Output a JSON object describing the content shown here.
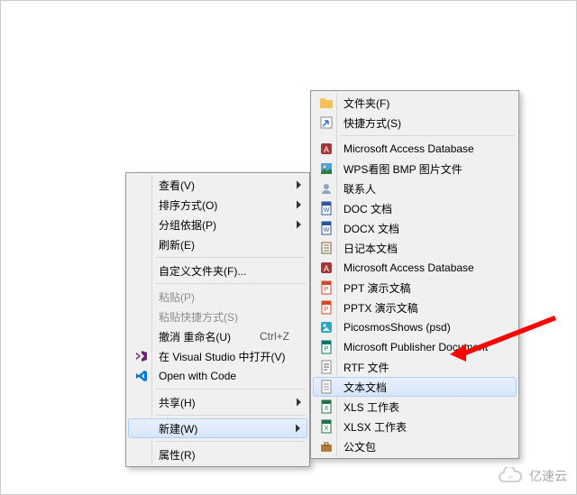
{
  "context_menu": {
    "items": [
      {
        "label": "查看(V)",
        "submenu": true
      },
      {
        "label": "排序方式(O)",
        "submenu": true
      },
      {
        "label": "分组依据(P)",
        "submenu": true
      },
      {
        "label": "刷新(E)"
      }
    ],
    "customize": {
      "label": "自定义文件夹(F)..."
    },
    "paste": {
      "label": "粘贴(P)",
      "disabled": true
    },
    "paste_shortcut": {
      "label": "粘贴快捷方式(S)",
      "disabled": true
    },
    "undo": {
      "label": "撤消 重命名(U)",
      "shortcut": "Ctrl+Z"
    },
    "open_vs": {
      "label": "在 Visual Studio 中打开(V)",
      "icon": "vs"
    },
    "open_code": {
      "label": "Open with Code",
      "icon": "vscode"
    },
    "share": {
      "label": "共享(H)",
      "submenu": true
    },
    "new": {
      "label": "新建(W)",
      "submenu": true,
      "highlight": true
    },
    "properties": {
      "label": "属性(R)"
    }
  },
  "submenu": [
    {
      "label": "文件夹(F)",
      "icon": "folder"
    },
    {
      "label": "快捷方式(S)",
      "icon": "shortcut"
    },
    {
      "sep": true
    },
    {
      "label": "Microsoft Access Database",
      "icon": "access"
    },
    {
      "label": "WPS看图 BMP 图片文件",
      "icon": "bmp"
    },
    {
      "label": "联系人",
      "icon": "contact"
    },
    {
      "label": "DOC 文档",
      "icon": "doc"
    },
    {
      "label": "DOCX 文档",
      "icon": "doc"
    },
    {
      "label": "日记本文档",
      "icon": "journal"
    },
    {
      "label": "Microsoft Access Database",
      "icon": "access"
    },
    {
      "label": "PPT 演示文稿",
      "icon": "ppt"
    },
    {
      "label": "PPTX 演示文稿",
      "icon": "ppt"
    },
    {
      "label": "PicosmosShows (psd)",
      "icon": "psd"
    },
    {
      "label": "Microsoft Publisher Document",
      "icon": "pub"
    },
    {
      "label": "RTF 文件",
      "icon": "rtf"
    },
    {
      "label": "文本文档",
      "icon": "txt",
      "highlight": true
    },
    {
      "label": "XLS 工作表",
      "icon": "xls"
    },
    {
      "label": "XLSX 工作表",
      "icon": "xls"
    },
    {
      "label": "公文包",
      "icon": "briefcase"
    }
  ],
  "watermark": {
    "text": "亿速云"
  }
}
